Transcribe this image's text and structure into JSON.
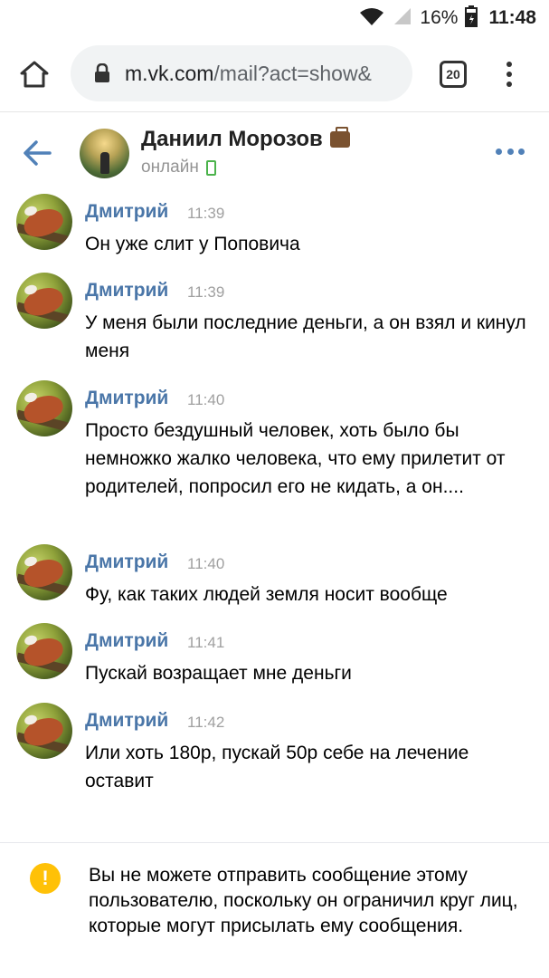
{
  "status_bar": {
    "battery_percent": "16%",
    "time": "11:48"
  },
  "browser": {
    "url_host": "m.vk.com",
    "url_path": "/mail?act=show&",
    "tabs_count": "20"
  },
  "chat_header": {
    "name": "Даниил Морозов",
    "status": "онлайн"
  },
  "messages": [
    {
      "author": "Дмитрий",
      "time": "11:39",
      "text": "Он уже слит у Поповича"
    },
    {
      "author": "Дмитрий",
      "time": "11:39",
      "text": "У меня были последние деньги, а он взял и кинул меня"
    },
    {
      "author": "Дмитрий",
      "time": "11:40",
      "text": "Просто бездушный человек, хоть было бы немножко жалко человека, что ему прилетит от родителей, попросил его не кидать, а он...."
    },
    {
      "author": "Дмитрий",
      "time": "11:40",
      "text": "Фу, как таких людей земля носит вообще"
    },
    {
      "author": "Дмитрий",
      "time": "11:41",
      "text": "Пускай возращает мне деньги"
    },
    {
      "author": "Дмитрий",
      "time": "11:42",
      "text": "Или хоть 180р, пускай 50р себе на лечение оставит"
    }
  ],
  "notice": {
    "icon": "!",
    "text": "Вы не можете отправить сообщение этому пользователю, поскольку он ограничил круг лиц, которые могут присылать ему сообщения."
  },
  "colors": {
    "accent": "#4a76a8",
    "online": "#4bb34b",
    "warning": "#ffc107"
  }
}
